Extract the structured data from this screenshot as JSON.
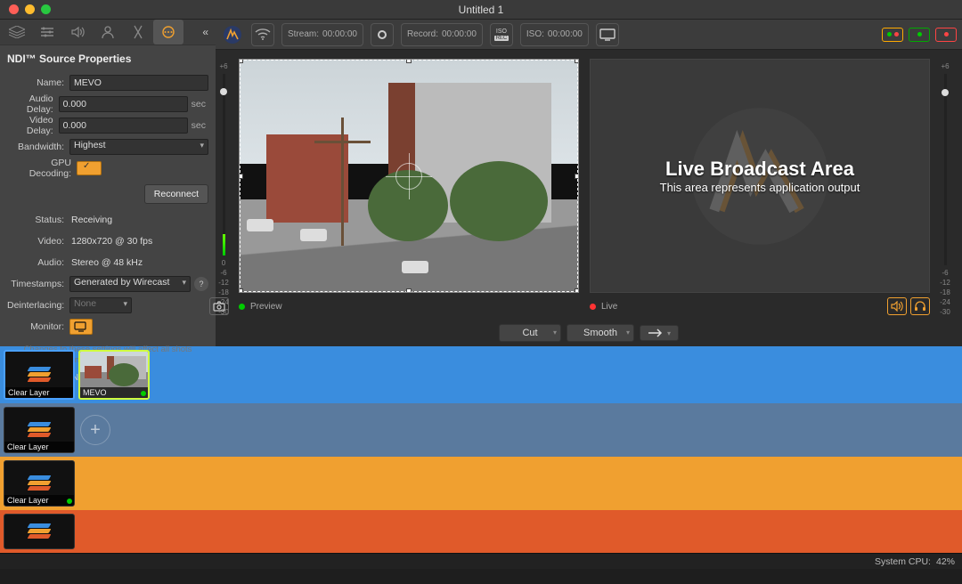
{
  "window": {
    "title": "Untitled 1"
  },
  "panel": {
    "title": "NDI™ Source Properties",
    "name_label": "Name:",
    "name_value": "MEVO",
    "audio_delay_label": "Audio Delay:",
    "audio_delay_value": "0.000",
    "audio_delay_unit": "sec",
    "video_delay_label": "Video Delay:",
    "video_delay_value": "0.000",
    "video_delay_unit": "sec",
    "bandwidth_label": "Bandwidth:",
    "bandwidth_value": "Highest",
    "gpu_label": "GPU Decoding:",
    "reconnect": "Reconnect",
    "status_label": "Status:",
    "status_value": "Receiving",
    "video_label": "Video:",
    "video_value": "1280x720 @ 30 fps",
    "audio_label": "Audio:",
    "audio_value": "Stereo @ 48 kHz",
    "timestamps_label": "Timestamps:",
    "timestamps_value": "Generated by Wirecast",
    "deinterlacing_label": "Deinterlacing:",
    "deinterlacing_value": "None",
    "monitor_label": "Monitor:",
    "note": "Changes to these settings will affect all shots containing this source.",
    "link": "NDI.NewTek.com"
  },
  "toolbar": {
    "stream_label": "Stream:",
    "stream_time": "00:00:00",
    "record_label": "Record:",
    "record_time": "00:00:00",
    "iso_label": "ISO:",
    "iso_time": "00:00:00"
  },
  "meter": {
    "ticks": [
      "+6",
      "0",
      "-6",
      "-12",
      "-18",
      "-24",
      "-30"
    ]
  },
  "preview": {
    "label": "Preview"
  },
  "live": {
    "label": "Live",
    "title": "Live Broadcast Area",
    "subtitle": "This area represents application output"
  },
  "transition": {
    "cut": "Cut",
    "smooth": "Smooth"
  },
  "layers": {
    "clear": "Clear Layer",
    "mevo": "MEVO"
  },
  "status": {
    "cpu_label": "System CPU:",
    "cpu_value": "42%"
  }
}
